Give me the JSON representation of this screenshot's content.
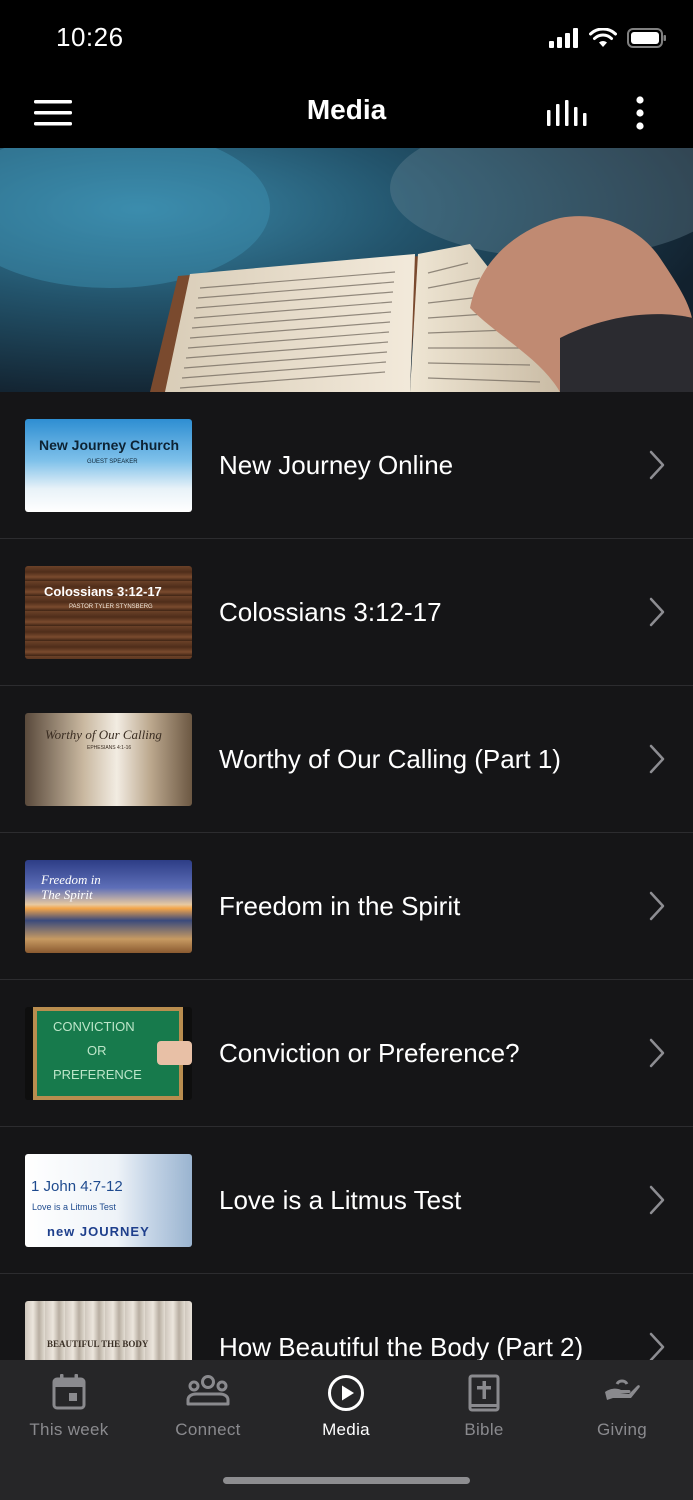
{
  "status": {
    "time": "10:26"
  },
  "nav": {
    "title": "Media"
  },
  "media_items": [
    {
      "title": "New Journey Online",
      "thumb_text": "New Journey Church",
      "thumb_sub": "GUEST SPEAKER"
    },
    {
      "title": "Colossians 3:12-17",
      "thumb_text": "Colossians 3:12-17",
      "thumb_sub": "PASTOR TYLER STYNSBERG"
    },
    {
      "title": "Worthy of Our Calling (Part 1)",
      "thumb_text": "Worthy of Our Calling",
      "thumb_sub": "EPHESIANS 4:1-16"
    },
    {
      "title": "Freedom in the Spirit",
      "thumb_text": "Freedom in The Spirit",
      "thumb_sub": ""
    },
    {
      "title": "Conviction or Preference?",
      "thumb_text": "CONVICTION",
      "thumb_sub": "OR",
      "thumb_sub2": "PREFERENCE"
    },
    {
      "title": "Love is a Litmus Test",
      "thumb_text": "1 John 4:7-12",
      "thumb_sub": "Love is a Litmus Test",
      "thumb_sub2": "new JOURNEY"
    },
    {
      "title": "How Beautiful the Body (Part 2)",
      "thumb_text": "BEAUTIFUL THE BODY"
    }
  ],
  "tabs": [
    {
      "label": "This week",
      "icon": "calendar-icon"
    },
    {
      "label": "Connect",
      "icon": "people-icon"
    },
    {
      "label": "Media",
      "icon": "play-circle-icon"
    },
    {
      "label": "Bible",
      "icon": "bible-icon"
    },
    {
      "label": "Giving",
      "icon": "giving-hand-icon"
    }
  ],
  "colors": {
    "background": "#151517",
    "bars": "#000000",
    "tab_bar": "#262628",
    "inactive_tab": "#8a8a8e"
  }
}
